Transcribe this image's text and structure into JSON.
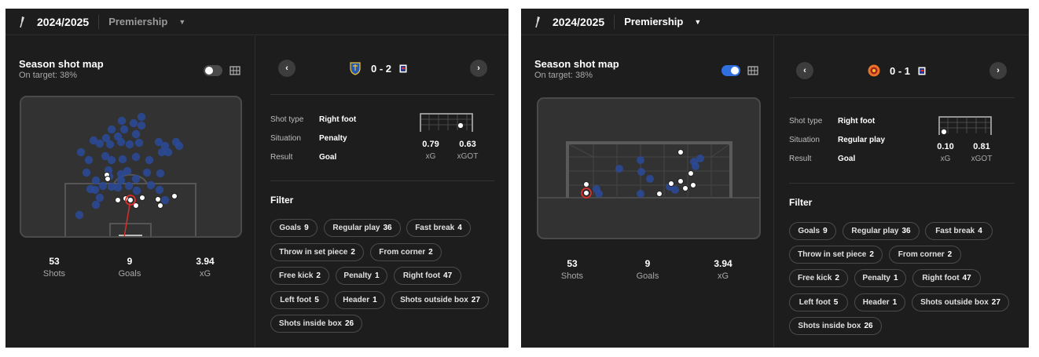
{
  "panels": [
    {
      "season": "2024/2025",
      "league": "Premiership",
      "map_title": "Season shot map",
      "map_sub": "On target: 38%",
      "stats": [
        {
          "value": "53",
          "label": "Shots"
        },
        {
          "value": "9",
          "label": "Goals"
        },
        {
          "value": "3.94",
          "label": "xG"
        }
      ],
      "score": "0 - 2",
      "nav_prev": "‹",
      "nav_next": "›",
      "details": [
        {
          "label": "Shot type",
          "value": "Right foot"
        },
        {
          "label": "Situation",
          "value": "Penalty"
        },
        {
          "label": "Result",
          "value": "Goal"
        }
      ],
      "xg": "0.79",
      "xg_label": "xG",
      "xgot": "0.63",
      "xgot_label": "xGOT",
      "filter_title": "Filter",
      "filters": [
        {
          "label": "Goals",
          "count": "9"
        },
        {
          "label": "Regular play",
          "count": "36"
        },
        {
          "label": "Fast break",
          "count": "4"
        },
        {
          "label": "Throw in set piece",
          "count": "2"
        },
        {
          "label": "From corner",
          "count": "2"
        },
        {
          "label": "Free kick",
          "count": "2"
        },
        {
          "label": "Penalty",
          "count": "1"
        },
        {
          "label": "Right foot",
          "count": "47"
        },
        {
          "label": "Left foot",
          "count": "5"
        },
        {
          "label": "Header",
          "count": "1"
        },
        {
          "label": "Shots outside box",
          "count": "27"
        },
        {
          "label": "Shots inside box",
          "count": "26"
        }
      ]
    },
    {
      "season": "2024/2025",
      "league": "Premiership",
      "map_title": "Season shot map",
      "map_sub": "On target: 38%",
      "stats": [
        {
          "value": "53",
          "label": "Shots"
        },
        {
          "value": "9",
          "label": "Goals"
        },
        {
          "value": "3.94",
          "label": "xG"
        }
      ],
      "score": "0 - 1",
      "nav_prev": "‹",
      "nav_next": "›",
      "details": [
        {
          "label": "Shot type",
          "value": "Right foot"
        },
        {
          "label": "Situation",
          "value": "Regular play"
        },
        {
          "label": "Result",
          "value": "Goal"
        }
      ],
      "xg": "0.10",
      "xg_label": "xG",
      "xgot": "0.81",
      "xgot_label": "xGOT",
      "filter_title": "Filter",
      "filters": [
        {
          "label": "Goals",
          "count": "9"
        },
        {
          "label": "Regular play",
          "count": "36"
        },
        {
          "label": "Fast break",
          "count": "4"
        },
        {
          "label": "Throw in set piece",
          "count": "2"
        },
        {
          "label": "From corner",
          "count": "2"
        },
        {
          "label": "Free kick",
          "count": "2"
        },
        {
          "label": "Penalty",
          "count": "1"
        },
        {
          "label": "Right foot",
          "count": "47"
        },
        {
          "label": "Left foot",
          "count": "5"
        },
        {
          "label": "Header",
          "count": "1"
        },
        {
          "label": "Shots outside box",
          "count": "27"
        },
        {
          "label": "Shots inside box",
          "count": "26"
        }
      ]
    }
  ],
  "colors": {
    "panel_bg": "#1d1d1d",
    "pitch_bg": "#323232",
    "shot_blue": "#2b4a9a",
    "toggle_on": "#2f6fe0",
    "toggle_off": "#4a4a4a",
    "selected_ring": "#d9302b"
  }
}
